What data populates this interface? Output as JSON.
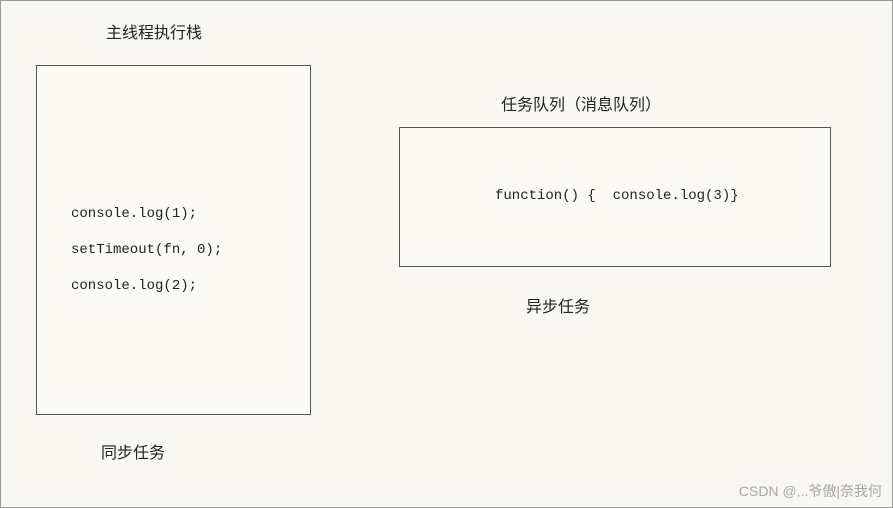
{
  "left": {
    "title": "主线程执行栈",
    "lines": [
      "console.log(1);",
      "setTimeout(fn, 0);",
      "console.log(2);"
    ],
    "label": "同步任务"
  },
  "right": {
    "title": "任务队列（消息队列）",
    "line": "function() {  console.log(3)}",
    "label": "异步任务"
  },
  "watermark": "CSDN @,..爷傲|奈我何"
}
